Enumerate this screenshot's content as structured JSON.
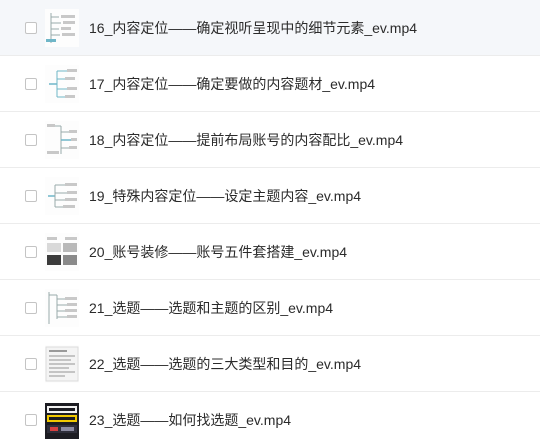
{
  "files": [
    {
      "name": "16_内容定位——确定视听呈现中的细节元素_ev.mp4",
      "thumbnail": "mindmap-thumbnail"
    },
    {
      "name": "17_内容定位——确定要做的内容题材_ev.mp4",
      "thumbnail": "mindmap-thumbnail"
    },
    {
      "name": "18_内容定位——提前布局账号的内容配比_ev.mp4",
      "thumbnail": "mindmap-thumbnail"
    },
    {
      "name": "19_特殊内容定位——设定主题内容_ev.mp4",
      "thumbnail": "mindmap-thumbnail"
    },
    {
      "name": "20_账号装修——账号五件套搭建_ev.mp4",
      "thumbnail": "screenshots-thumbnail"
    },
    {
      "name": "21_选题——选题和主题的区别_ev.mp4",
      "thumbnail": "mindmap-thumbnail"
    },
    {
      "name": "22_选题——选题的三大类型和目的_ev.mp4",
      "thumbnail": "document-thumbnail"
    },
    {
      "name": "23_选题——如何找选题_ev.mp4",
      "thumbnail": "video-cover-thumbnail"
    }
  ],
  "colors": {
    "text": "#2b2b2b",
    "divider": "#ececec",
    "checkbox_border": "#c4c4c4",
    "mindmap_accent": "#6fb6c8"
  }
}
